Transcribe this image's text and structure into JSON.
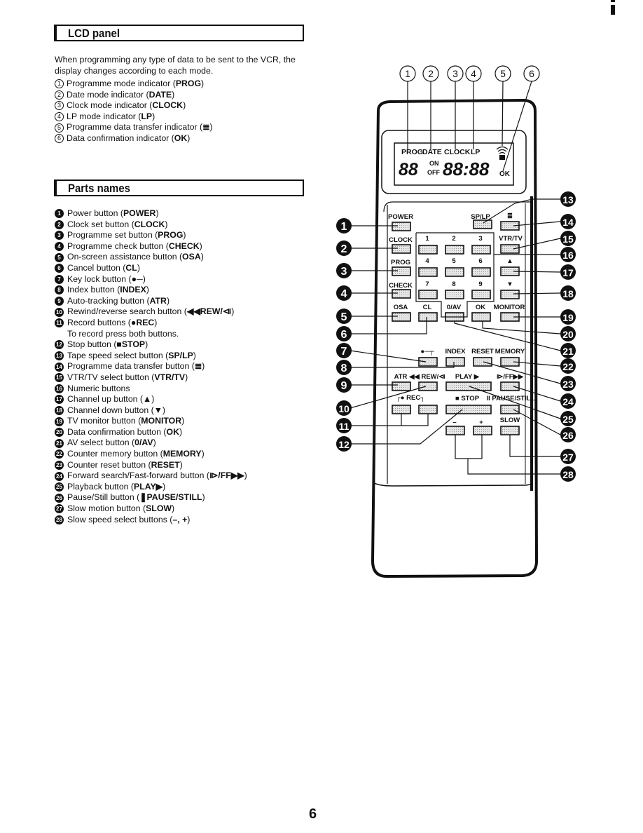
{
  "page": {
    "number": "6"
  },
  "lcd_section": {
    "title": "LCD panel",
    "intro": "When programming any type of data to be sent to the VCR, the display changes according to each mode.",
    "items": [
      {
        "num": "1",
        "text": "Programme mode indicator (",
        "bold": "PROG",
        "end": ")"
      },
      {
        "num": "2",
        "text": "Date mode indicator (",
        "bold": "DATE",
        "end": ")"
      },
      {
        "num": "3",
        "text": "Clock mode indicator (",
        "bold": "CLOCK",
        "end": ")"
      },
      {
        "num": "4",
        "text": "LP mode indicator (",
        "bold": "LP",
        "end": ")"
      },
      {
        "num": "5",
        "text": "Programme data transfer indicator ( ",
        "bold": "≣",
        "end": " )"
      },
      {
        "num": "6",
        "text": "Data confirmation indicator (",
        "bold": "OK",
        "end": ")"
      }
    ]
  },
  "parts_section": {
    "title": "Parts names",
    "items": [
      {
        "num": "1",
        "text": "Power button (",
        "bold": "POWER",
        "end": ")"
      },
      {
        "num": "2",
        "text": "Clock set button (",
        "bold": "CLOCK",
        "end": ")"
      },
      {
        "num": "3",
        "text": "Programme set button (",
        "bold": "PROG",
        "end": ")"
      },
      {
        "num": "4",
        "text": "Programme check button (",
        "bold": "CHECK",
        "end": ")"
      },
      {
        "num": "5",
        "text": "On-screen assistance button (",
        "bold": "OSA",
        "end": ")"
      },
      {
        "num": "6",
        "text": "Cancel button (",
        "bold": "CL",
        "end": ")"
      },
      {
        "num": "7",
        "text": "Key lock button (",
        "bold": "●─",
        "end": ")"
      },
      {
        "num": "8",
        "text": "Index button (",
        "bold": "INDEX",
        "end": ")"
      },
      {
        "num": "9",
        "text": "Auto-tracking button (",
        "bold": "ATR",
        "end": ")"
      },
      {
        "num": "10",
        "text": "Rewind/reverse search button (",
        "bold": "◀◀REW/⧏",
        "end": ")"
      },
      {
        "num": "11",
        "text": "Record buttons (",
        "bold": "●REC",
        "end": ")",
        "note": "To record press both buttons."
      },
      {
        "num": "12",
        "text": "Stop button (",
        "bold": "■STOP",
        "end": ")"
      },
      {
        "num": "13",
        "text": "Tape speed select button (",
        "bold": "SP/LP",
        "end": ")"
      },
      {
        "num": "14",
        "text": "Programme data transfer button ( ",
        "bold": "≣",
        "end": " )"
      },
      {
        "num": "15",
        "text": "VTR/TV select button (",
        "bold": "VTR/TV",
        "end": ")"
      },
      {
        "num": "16",
        "text": "Numeric buttons",
        "bold": "",
        "end": ""
      },
      {
        "num": "17",
        "text": "Channel up button (",
        "bold": "▲",
        "end": ")"
      },
      {
        "num": "18",
        "text": "Channel down button (",
        "bold": "▼",
        "end": ")"
      },
      {
        "num": "19",
        "text": "TV monitor button (",
        "bold": "MONITOR",
        "end": ")"
      },
      {
        "num": "20",
        "text": "Data confirmation button (",
        "bold": "OK",
        "end": ")"
      },
      {
        "num": "21",
        "text": "AV select button (",
        "bold": "0/AV",
        "end": ")"
      },
      {
        "num": "22",
        "text": "Counter memory button (",
        "bold": "MEMORY",
        "end": ")"
      },
      {
        "num": "23",
        "text": "Counter reset button (",
        "bold": "RESET",
        "end": ")"
      },
      {
        "num": "24",
        "text": "Forward search/Fast-forward button (",
        "bold": "⧐/FF▶▶",
        "end": ")"
      },
      {
        "num": "25",
        "text": "Playback button (",
        "bold": "PLAY▶",
        "end": ")"
      },
      {
        "num": "26",
        "text": "Pause/Still button (",
        "bold": "❚PAUSE/STILL",
        "end": ")"
      },
      {
        "num": "27",
        "text": "Slow motion button (",
        "bold": "SLOW",
        "end": ")"
      },
      {
        "num": "28",
        "text": "Slow speed select buttons (",
        "bold": "–, +",
        "end": ")"
      }
    ]
  },
  "remote": {
    "lcd": {
      "labels": [
        "PROG",
        "DATE",
        "CLOCK",
        "LP"
      ],
      "on": "ON",
      "off": "OFF",
      "ok": "OK",
      "digits_left": "88",
      "digits_time": "88:88",
      "callouts": [
        "1",
        "2",
        "3",
        "4",
        "5",
        "6"
      ]
    },
    "buttons": {
      "power": "POWER",
      "clock": "CLOCK",
      "prog": "PROG",
      "check": "CHECK",
      "osa": "OSA",
      "splp": "SP/LP",
      "transfer": "≣",
      "vtrtv": "VTR/TV",
      "up": "▲",
      "down": "▼",
      "n1": "1",
      "n2": "2",
      "n3": "3",
      "n4": "4",
      "n5": "5",
      "n6": "6",
      "n7": "7",
      "n8": "8",
      "n9": "9",
      "cl": "CL",
      "av": "0/AV",
      "ok": "OK",
      "monitor": "MONITOR",
      "keylock": "●─┬",
      "index": "INDEX",
      "reset": "RESET",
      "memory": "MEMORY",
      "atr": "ATR",
      "rew": "◀◀ REW/⧏",
      "play": "PLAY ▶",
      "ff": "⧐/FF▶▶",
      "rec": "┌● REC┐",
      "stop": "■ STOP",
      "pause": "II PAUSE/STILL",
      "minus": "–",
      "plus": "+",
      "slow": "SLOW"
    },
    "callouts_left": [
      "1",
      "2",
      "3",
      "4",
      "5",
      "6",
      "7",
      "8",
      "9",
      "10",
      "11",
      "12"
    ],
    "callouts_right": [
      "13",
      "14",
      "15",
      "16",
      "17",
      "18",
      "19",
      "20",
      "21",
      "22",
      "23",
      "24",
      "25",
      "26",
      "27",
      "28"
    ]
  }
}
